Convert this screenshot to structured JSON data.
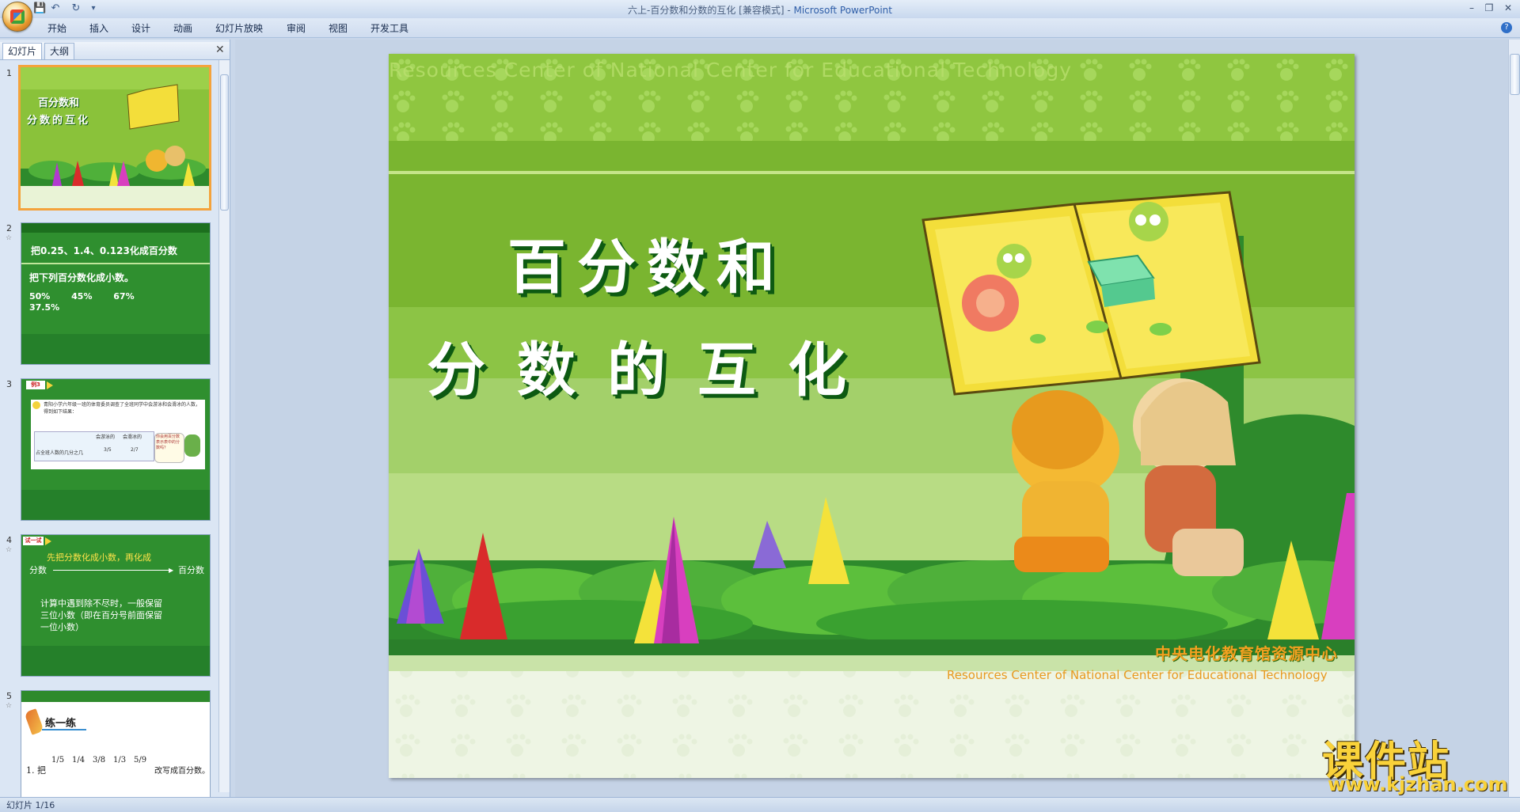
{
  "window": {
    "title": "六上-百分数和分数的互化 [兼容模式] - Microsoft PowerPoint",
    "title_doc": "六上-百分数和分数的互化 [兼容模式]",
    "title_sep": " - ",
    "title_app": "Microsoft PowerPoint",
    "minimize": "–",
    "restore": "❐",
    "close": "✕"
  },
  "qat": {
    "save": "💾",
    "undo": "↶",
    "redo": "↻",
    "more": "▾"
  },
  "ribbon": {
    "tabs": [
      "开始",
      "插入",
      "设计",
      "动画",
      "幻灯片放映",
      "审阅",
      "视图",
      "开发工具"
    ],
    "help": "?"
  },
  "panel": {
    "tab_slides": "幻灯片",
    "tab_outline": "大纲",
    "close": "✕",
    "slides": [
      {
        "num": "1",
        "title_line1": "百分数和",
        "title_line2": "分数的互化"
      },
      {
        "num": "2",
        "line1": "把0.25、1.4、0.123化成百分数",
        "line2": "把下列百分数化成小数。",
        "line3": "50%       45%       67%",
        "line4": "37.5%"
      },
      {
        "num": "3",
        "tag": "例3",
        "text": "青阳小学六年级一班的体育委员调查了全班同学中会游泳和会滑冰的人数，得到如下结果：",
        "col1": "会游泳的",
        "col2": "会滑冰的",
        "rowlabel": "占全班人数的几分之几",
        "v1": "3/5",
        "v2": "2/7",
        "bubble": "你会用百分数表示表中的分数吗？"
      },
      {
        "num": "4",
        "tag": "试一试",
        "line1": "先把分数化成小数，再化成",
        "left": "分数",
        "right": "百分数",
        "note1": "计算中遇到除不尽时，一般保留",
        "note2": "三位小数（即在百分号前面保留",
        "note3": "一位小数）"
      },
      {
        "num": "5",
        "heading": "练一练",
        "exercise_prefix": "1. 把",
        "fractions": [
          "1/5",
          "1/4",
          "3/8",
          "1/3",
          "5/9"
        ],
        "exercise_suffix": "改写成百分数。"
      }
    ]
  },
  "slide": {
    "bg_text_top": "Resources Center of National Center for Educational Technology",
    "title_line1": "百分数和",
    "title_line2": "分数的互化",
    "logo_cn": "中央电化教育馆资源中心",
    "logo_en": "Resources Center of National Center for Educational Technology"
  },
  "status": {
    "text": "幻灯片 1/16"
  },
  "watermark": {
    "cn": "课件站",
    "url": "www.kjzhan.com"
  },
  "colors": {
    "slide_green": "#8ac23a",
    "dark_green": "#2e8a2c",
    "title_shadow": "#0d5a12",
    "selection": "#f4a33c"
  }
}
